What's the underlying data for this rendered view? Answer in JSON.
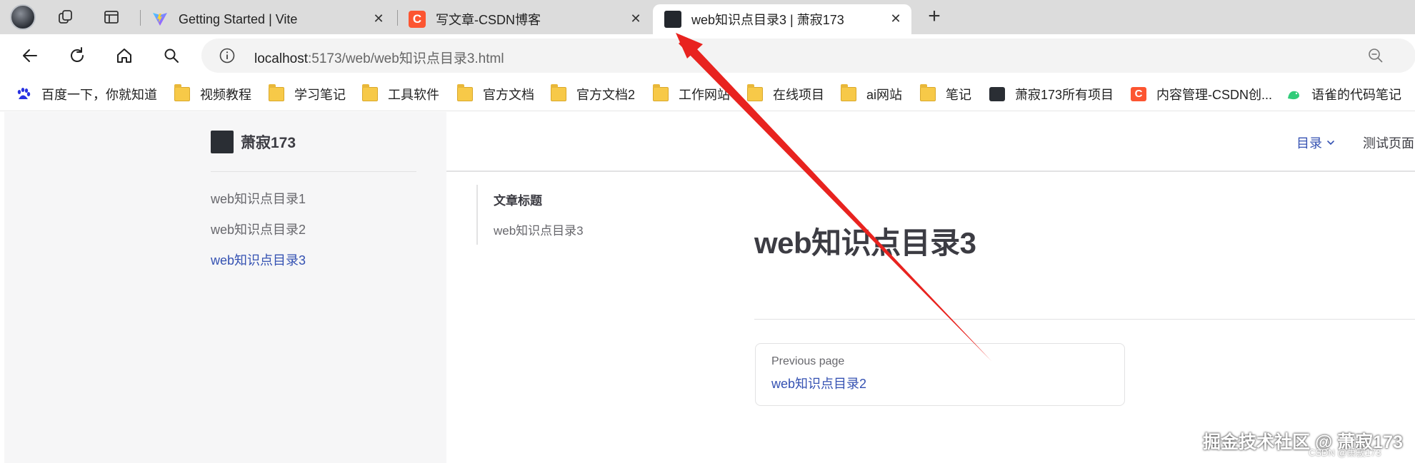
{
  "browser": {
    "tabs": [
      {
        "title": "Getting Started | Vite",
        "icon": "vite-icon",
        "active": false
      },
      {
        "title": "写文章-CSDN博客",
        "icon": "csdn-icon",
        "active": false
      },
      {
        "title": "web知识点目录3 | 萧寂173",
        "icon": "site-avatar-icon",
        "active": true
      }
    ],
    "new_tab_symbol": "+",
    "url_host": "localhost",
    "url_path": ":5173/web/web知识点目录3.html"
  },
  "bookmarks": [
    {
      "label": "百度一下，你就知道",
      "icon": "baidu-icon"
    },
    {
      "label": "视频教程",
      "icon": "folder-icon"
    },
    {
      "label": "学习笔记",
      "icon": "folder-icon"
    },
    {
      "label": "工具软件",
      "icon": "folder-icon"
    },
    {
      "label": "官方文档",
      "icon": "folder-icon"
    },
    {
      "label": "官方文档2",
      "icon": "folder-icon"
    },
    {
      "label": "工作网站",
      "icon": "folder-icon"
    },
    {
      "label": "在线项目",
      "icon": "folder-icon"
    },
    {
      "label": "ai网站",
      "icon": "folder-icon"
    },
    {
      "label": "笔记",
      "icon": "folder-icon"
    },
    {
      "label": "萧寂173所有项目",
      "icon": "user-avatar-icon"
    },
    {
      "label": "内容管理-CSDN创...",
      "icon": "csdn-icon"
    },
    {
      "label": "语雀的代码笔记",
      "icon": "yuque-icon"
    }
  ],
  "site": {
    "title": "萧寂173",
    "sidebar_links": [
      "web知识点目录1",
      "web知识点目录2",
      "web知识点目录3"
    ],
    "active_link_index": 2,
    "nav": {
      "menu_label": "目录",
      "test_label": "测试页面"
    },
    "outline": {
      "title": "文章标题",
      "items": [
        "web知识点目录3"
      ]
    },
    "doc_title": "web知识点目录3",
    "prev": {
      "desc": "Previous page",
      "title": "web知识点目录2"
    }
  },
  "watermark": {
    "main": "掘金技术社区 @ 萧寂173",
    "sub": "CSDN @萧寂173"
  },
  "colors": {
    "accent": "#3451b2",
    "arrow": "#e8231f",
    "csdn": "#fc5531"
  }
}
